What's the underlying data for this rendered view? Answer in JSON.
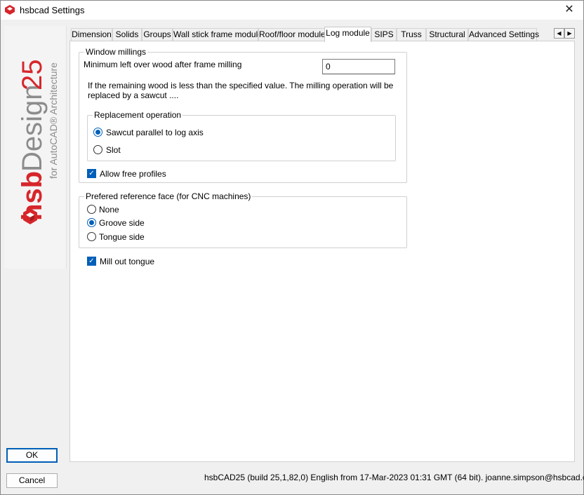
{
  "window": {
    "title": "hsbcad Settings",
    "close_glyph": "✕",
    "accent_color": "#005fb8",
    "brand_red": "#d6262b",
    "brand_gray": "#8c8c8c"
  },
  "brand": {
    "hsb": "hsb",
    "design": "Design",
    "version": "25",
    "tagline": "for AutoCAD® Architecture"
  },
  "tabs": [
    {
      "label": "Dimension",
      "active": false
    },
    {
      "label": "Solids",
      "active": false
    },
    {
      "label": "Groups",
      "active": false
    },
    {
      "label": "Wall stick frame module",
      "active": false
    },
    {
      "label": "Roof/floor module",
      "active": false
    },
    {
      "label": "Log module",
      "active": true
    },
    {
      "label": "SIPS",
      "active": false
    },
    {
      "label": "Truss",
      "active": false
    },
    {
      "label": "Structural",
      "active": false
    },
    {
      "label": "Advanced Settings",
      "active": false
    }
  ],
  "tab_scroll": {
    "left": "◀",
    "right": "▶"
  },
  "window_millings": {
    "title": "Window millings",
    "min_label": "Minimum left over wood after frame milling",
    "min_value": "0",
    "info": "If the remaining wood is less than the specified value. The milling operation will be replaced by a sawcut ....",
    "replacement": {
      "title": "Replacement operation",
      "options": [
        {
          "label": "Sawcut parallel to log axis",
          "checked": true
        },
        {
          "label": "Slot",
          "checked": false
        }
      ]
    },
    "allow_free_profiles": {
      "label": "Allow free profiles",
      "checked": true
    }
  },
  "reference_face": {
    "title": "Prefered reference face (for CNC machines)",
    "options": [
      {
        "label": "None",
        "checked": false
      },
      {
        "label": "Groove side",
        "checked": true
      },
      {
        "label": "Tongue side",
        "checked": false
      }
    ]
  },
  "mill_out_tongue": {
    "label": "Mill out tongue",
    "checked": true
  },
  "buttons": {
    "ok": "OK",
    "cancel": "Cancel"
  },
  "status": "hsbCAD25 (build 25,1,82,0) English from 17-Mar-2023 01:31 GMT (64 bit). joanne.simpson@hsbcad.com"
}
